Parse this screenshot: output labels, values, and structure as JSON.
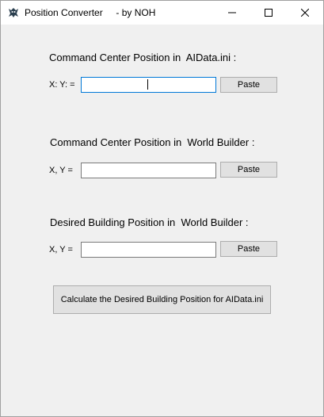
{
  "window": {
    "title": "Position Converter     - by NOH",
    "app_icon": "robot-icon",
    "minimize_icon": "minimize-icon",
    "maximize_icon": "maximize-icon",
    "close_icon": "close-icon"
  },
  "sections": {
    "aidata": {
      "heading": "Command Center Position in  AIData.ini :",
      "coord_label": "X: Y: =",
      "value": "",
      "paste_label": "Paste"
    },
    "cc_world_builder": {
      "heading": "Command Center Position in  World Builder :",
      "coord_label": "X, Y =",
      "value": "",
      "paste_label": "Paste"
    },
    "desired_world_builder": {
      "heading": "Desired Building Position in  World Builder :",
      "coord_label": "X, Y =",
      "value": "",
      "paste_label": "Paste"
    }
  },
  "calculate_label": "Calculate the Desired Building Position for  AIData.ini",
  "colors": {
    "focus_border": "#0078d7",
    "window_bg": "#f0f0f0",
    "button_bg": "#e1e1e1"
  }
}
